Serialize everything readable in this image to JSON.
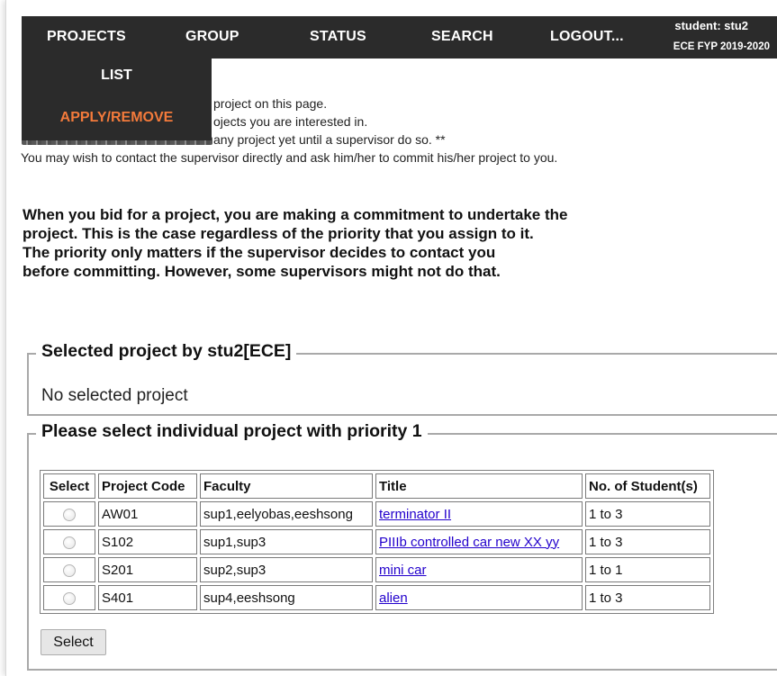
{
  "nav": {
    "projects": "PROJECTS",
    "group": "GROUP",
    "status": "STATUS",
    "search": "SEARCH",
    "logout": "LOGOUT...",
    "user": "student: stu2",
    "term": "ECE FYP 2019-2020"
  },
  "dropdown": {
    "list": "LIST",
    "apply": "APPLY/REMOVE",
    "apply_color": "#f37a3b"
  },
  "intro": {
    "line1": "project on this page.",
    "line2": "ojects you are interested in.",
    "line3": "any project yet until a supervisor do so. **",
    "line4": "You may wish to contact the supervisor directly and ask him/her to commit his/her project to you."
  },
  "notice": {
    "line1": "When you bid for a project, you are making a commitment to undertake the",
    "line2": "project. This is the case regardless of the priority that you assign to it.",
    "line3": "The priority only matters if the supervisor decides to contact you",
    "line4": "before committing. However, some supervisors might not do that."
  },
  "selected": {
    "legend": "Selected project by stu2[ECE]",
    "empty_text": "No selected project"
  },
  "priority": {
    "legend": "Please select individual project with priority 1",
    "headers": [
      "Select",
      "Project Code",
      "Faculty",
      "Title",
      "No. of Student(s)"
    ],
    "rows": [
      {
        "code": "AW01",
        "faculty": "sup1,eelyobas,eeshsong",
        "title": "terminator II",
        "students": "1 to 3"
      },
      {
        "code": "S102",
        "faculty": "sup1,sup3",
        "title": "PIIIb controlled car new XX yy",
        "students": "1 to 3"
      },
      {
        "code": "S201",
        "faculty": "sup2,sup3",
        "title": "mini car",
        "students": "1 to 1"
      },
      {
        "code": "S401",
        "faculty": "sup4,eeshsong",
        "title": "alien",
        "students": "1 to 3"
      }
    ],
    "button": "Select"
  },
  "colors": {
    "navbar": "#2b2b2b",
    "link": "#2200cc"
  }
}
